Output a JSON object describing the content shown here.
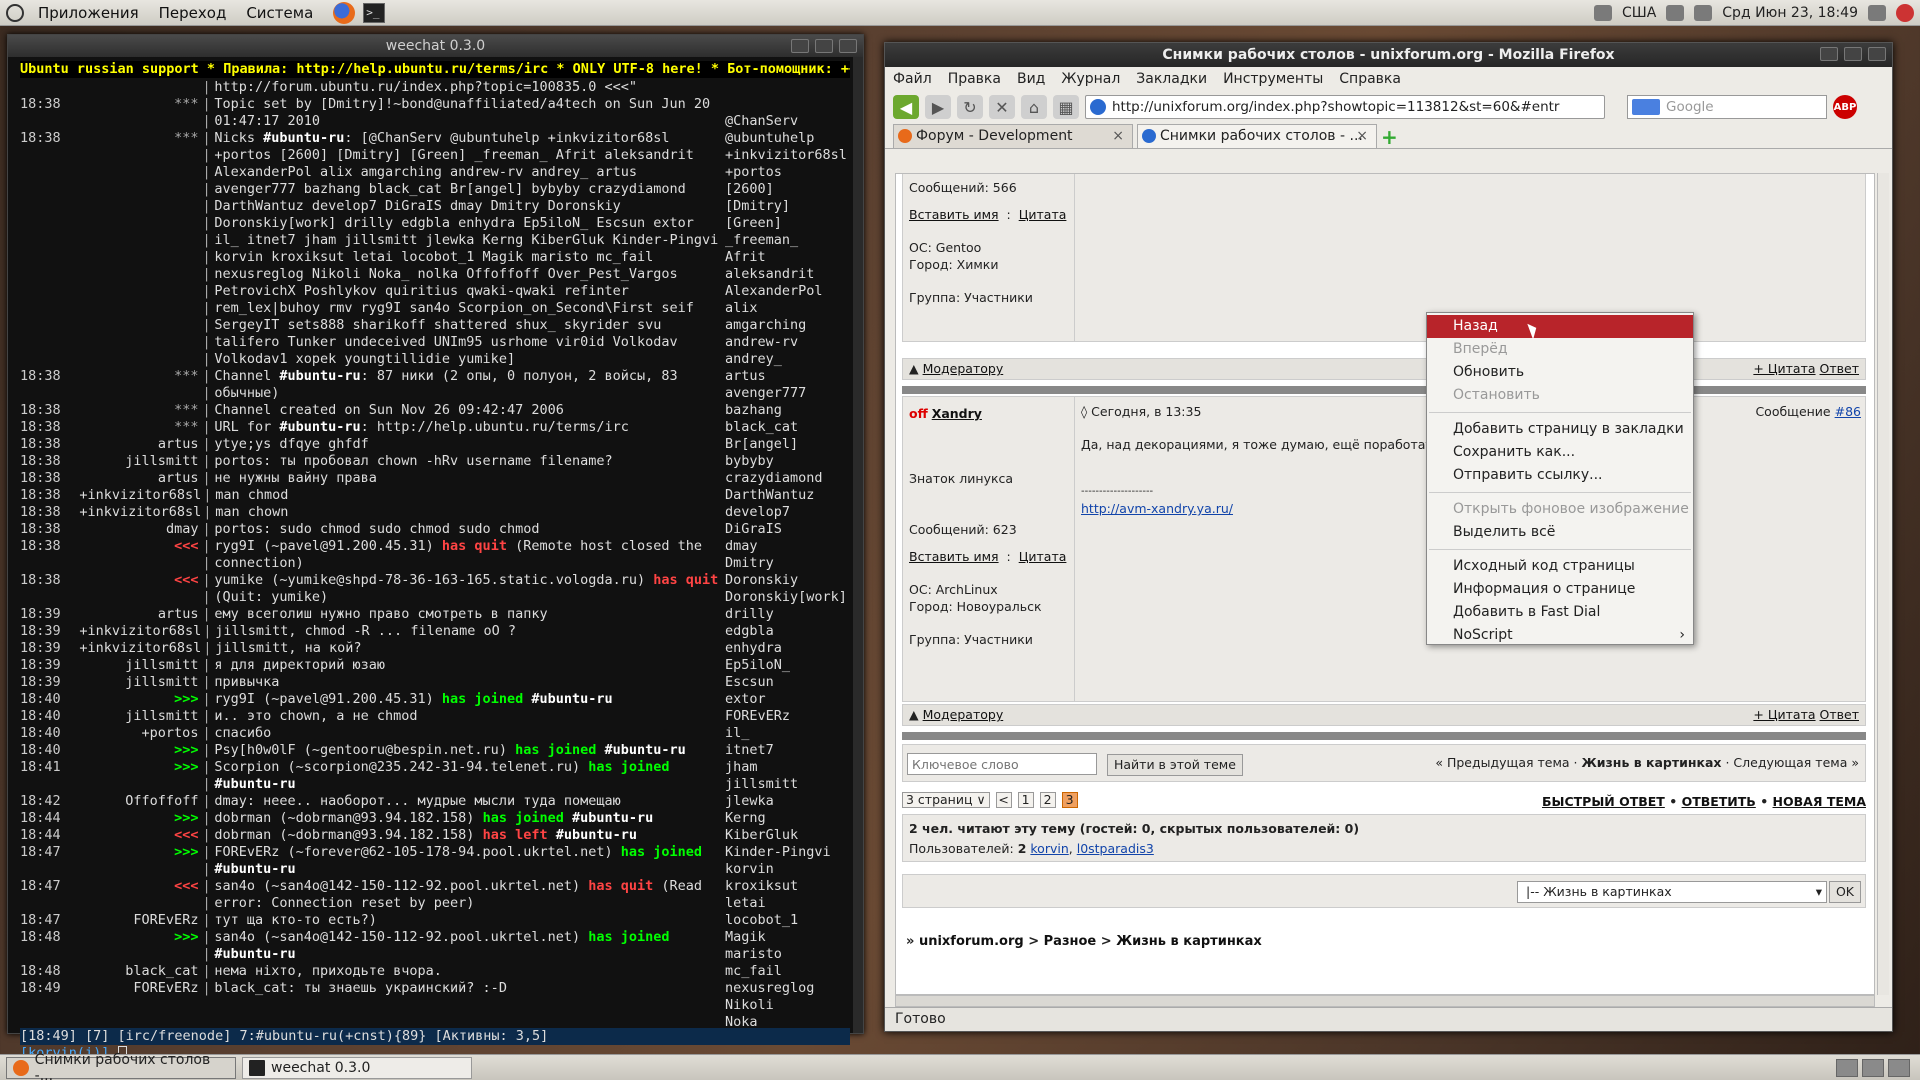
{
  "top_panel": {
    "menus": [
      "Приложения",
      "Переход",
      "Система"
    ],
    "keyboard_layout": "США",
    "datetime": "Срд Июн 23, 18:49"
  },
  "bottom_panel": {
    "tasks": [
      "Снимки рабочих столов -...",
      "weechat 0.3.0"
    ]
  },
  "terminal": {
    "title": "weechat 0.3.0",
    "topic": "Ubuntu russian support * Правила: http://help.ubuntu.ru/terms/irc * ONLY UTF-8 here! * Бот-помощник: ++",
    "lines": [
      {
        "t": "",
        "n": "",
        "m": "http://forum.ubuntu.ru/index.php?topic=100835.0 <<<\""
      },
      {
        "t": "18:38",
        "n": "***",
        "m": "Topic set by [Dmitry]!~bond@unaffiliated/a4tech on Sun Jun 20"
      },
      {
        "t": "",
        "n": "",
        "m": "01:47:17 2010"
      },
      {
        "t": "18:38",
        "n": "***",
        "m": "Nicks #ubuntu-ru: [@ChanServ @ubuntuhelp +inkvizitor68sl"
      },
      {
        "t": "",
        "n": "",
        "m": "+portos [2600] [Dmitry] [Green] _freeman_ Afrit aleksandrit"
      },
      {
        "t": "",
        "n": "",
        "m": "AlexanderPol alix amgarching andrew-rv andrey_ artus"
      },
      {
        "t": "",
        "n": "",
        "m": "avenger777 bazhang black_cat Br[angel] bybyby crazydiamond"
      },
      {
        "t": "",
        "n": "",
        "m": "DarthWantuz develop7 DiGraIS dmay Dmitry Doronskiy"
      },
      {
        "t": "",
        "n": "",
        "m": "Doronskiy[work] drilly edgbla enhydra Ep5iloN_ Escsun extor"
      },
      {
        "t": "",
        "n": "",
        "m": "il_ itnet7 jham jillsmitt jlewka Kerng KiberGluk Kinder-Pingvi"
      },
      {
        "t": "",
        "n": "",
        "m": "korvin kroxiksut letai locobot_1 Magik maristo mc_fail"
      },
      {
        "t": "",
        "n": "",
        "m": "nexusreglog Nikoli Noka_ nolka Offoffoff Over_Pest_Vargos"
      },
      {
        "t": "",
        "n": "",
        "m": "PetrovichX Poshlykov quiritius qwaki-qwaki refinter"
      },
      {
        "t": "",
        "n": "",
        "m": "rem_lex|buhoy rmv ryg9I san4o Scorpion_on_Second\\First seif"
      },
      {
        "t": "",
        "n": "",
        "m": "SergeyIT sets888 sharikoff shattered shux_ skyrider svu"
      },
      {
        "t": "",
        "n": "",
        "m": "talifero Tunker undeceived UNIm95 usrhome vir0id Volkodav"
      },
      {
        "t": "",
        "n": "",
        "m": "Volkodav1 xopek youngtillidie yumike]"
      },
      {
        "t": "18:38",
        "n": "***",
        "m": "Channel #ubuntu-ru: 87 ники (2 опы, 0 полуон, 2 войсы, 83"
      },
      {
        "t": "",
        "n": "",
        "m": "обычные)"
      },
      {
        "t": "18:38",
        "n": "***",
        "m": "Channel created on Sun Nov 26 09:42:47 2006"
      },
      {
        "t": "18:38",
        "n": "***",
        "m": "URL for #ubuntu-ru: http://help.ubuntu.ru/terms/irc"
      },
      {
        "t": "18:38",
        "n": "artus",
        "m": "ytye;ys dfqye ghfdf"
      },
      {
        "t": "18:38",
        "n": "jillsmitt",
        "m": "portos: ты пробовал chown -hRv username filename?"
      },
      {
        "t": "18:38",
        "n": "artus",
        "m": "не нужны вайну права"
      },
      {
        "t": "18:38",
        "n": "+inkvizitor68sl",
        "m": "man chmod"
      },
      {
        "t": "18:38",
        "n": "+inkvizitor68sl",
        "m": "man chown"
      },
      {
        "t": "18:38",
        "n": "dmay",
        "m": "portos: sudo chmod sudo chmod sudo chmod"
      },
      {
        "t": "18:38",
        "n": "<<<",
        "m": "ryg9I (~pavel@91.200.45.31) has quit (Remote host closed the"
      },
      {
        "t": "",
        "n": "",
        "m": "connection)"
      },
      {
        "t": "18:38",
        "n": "<<<",
        "m": "yumike (~yumike@shpd-78-36-163-165.static.vologda.ru) has quit"
      },
      {
        "t": "",
        "n": "",
        "m": "(Quit: yumike)"
      },
      {
        "t": "18:39",
        "n": "artus",
        "m": "ему всеголиш нужно право смотреть в папку"
      },
      {
        "t": "18:39",
        "n": "+inkvizitor68sl",
        "m": "jillsmitt, chmod -R ... filename oO ?"
      },
      {
        "t": "18:39",
        "n": "+inkvizitor68sl",
        "m": "jillsmitt, на кой?"
      },
      {
        "t": "18:39",
        "n": "jillsmitt",
        "m": "я для директорий юзаю"
      },
      {
        "t": "18:39",
        "n": "jillsmitt",
        "m": "привычка"
      },
      {
        "t": "18:40",
        "n": ">>>",
        "m": "ryg9I (~pavel@91.200.45.31) has joined #ubuntu-ru"
      },
      {
        "t": "18:40",
        "n": "jillsmitt",
        "m": "и.. это chown, а не chmod"
      },
      {
        "t": "18:40",
        "n": "+portos",
        "m": "спасибо"
      },
      {
        "t": "18:40",
        "n": ">>>",
        "m": "Psy[h0w0lF (~gentooru@bespin.net.ru) has joined #ubuntu-ru"
      },
      {
        "t": "18:41",
        "n": ">>>",
        "m": "Scorpion (~scorpion@235.242-31-94.telenet.ru) has joined"
      },
      {
        "t": "",
        "n": "",
        "m": "#ubuntu-ru"
      },
      {
        "t": "18:42",
        "n": "Offoffoff",
        "m": "dmay: неее.. наоборот... мудрые мысли туда помещаю"
      },
      {
        "t": "18:44",
        "n": ">>>",
        "m": "dobrman (~dobrman@93.94.182.158) has joined #ubuntu-ru"
      },
      {
        "t": "18:44",
        "n": "<<<",
        "m": "dobrman (~dobrman@93.94.182.158) has left #ubuntu-ru"
      },
      {
        "t": "18:47",
        "n": ">>>",
        "m": "FOREvERz (~forever@62-105-178-94.pool.ukrtel.net) has joined"
      },
      {
        "t": "",
        "n": "",
        "m": "#ubuntu-ru"
      },
      {
        "t": "18:47",
        "n": "<<<",
        "m": "san4o (~san4o@142-150-112-92.pool.ukrtel.net) has quit (Read"
      },
      {
        "t": "",
        "n": "",
        "m": "error: Connection reset by peer)"
      },
      {
        "t": "18:47",
        "n": "FOREvERz",
        "m": "тут ща кто-то есть?)"
      },
      {
        "t": "18:48",
        "n": ">>>",
        "m": "san4o (~san4o@142-150-112-92.pool.ukrtel.net) has joined"
      },
      {
        "t": "",
        "n": "",
        "m": "#ubuntu-ru"
      },
      {
        "t": "18:48",
        "n": "black_cat",
        "m": "нема ніхто, приходьте вчора."
      },
      {
        "t": "18:49",
        "n": "FOREvERz",
        "m": "black_cat: ты знаешь украинский? :-D"
      }
    ],
    "nicks": [
      "@ChanServ",
      "@ubuntuhelp",
      "+inkvizitor68sl",
      "+portos",
      "[2600]",
      "[Dmitry]",
      "[Green]",
      "_freeman_",
      "Afrit",
      "aleksandrit",
      "AlexanderPol",
      "alix",
      "amgarching",
      "andrew-rv",
      "andrey_",
      "artus",
      "avenger777",
      "bazhang",
      "black_cat",
      "Br[angel]",
      "bybyby",
      "crazydiamond",
      "DarthWantuz",
      "develop7",
      "DiGraIS",
      "dmay",
      "Dmitry",
      "Doronskiy",
      "Doronskiy[work]",
      "drilly",
      "edgbla",
      "enhydra",
      "Ep5iloN_",
      "Escsun",
      "extor",
      "FOREvERz",
      "il_",
      "itnet7",
      "jham",
      "jillsmitt",
      "jlewka",
      "Kerng",
      "KiberGluk",
      "Kinder-Pingvi",
      "korvin",
      "kroxiksut",
      "letai",
      "locobot_1",
      "Magik",
      "maristo",
      "mc_fail",
      "nexusreglog",
      "Nikoli",
      "Noka_"
    ],
    "status_line": "[18:49] [7] [irc/freenode] 7:#ubuntu-ru(+cnst){89} [Активны: 3,5]",
    "input_prompt": "[korvin(i)]"
  },
  "firefox": {
    "title": "Снимки рабочих столов - unixforum.org - Mozilla Firefox",
    "menu": [
      "Файл",
      "Правка",
      "Вид",
      "Журнал",
      "Закладки",
      "Инструменты",
      "Справка"
    ],
    "url": "http://unixforum.org/index.php?showtopic=113812&st=60&#entr",
    "search_placeholder": "Google",
    "tabs": [
      "Форум - Development",
      "Снимки рабочих столов - ..."
    ],
    "status": "Готово",
    "post1": {
      "messages": "Сообщений: 566",
      "insert_name": "Вставить имя",
      "quote": "Цитата",
      "os": "ОС: Gentoo",
      "city": "Город: Химки",
      "group": "Группа: Участники",
      "moderator": "Модератору",
      "quote_link": "+ Цитата",
      "reply": "Ответ"
    },
    "post2": {
      "status": "off",
      "author": "Xandry",
      "date": "◊ Сегодня, в 13:35",
      "msg_label": "Сообщение",
      "msg_num": "#86",
      "rank": "Знаток линукса",
      "text": "Да, над декорациями, я тоже думаю, ещё поработать н",
      "sig_line": "--------------------",
      "sig_link": "http://avm-xandry.ya.ru/",
      "messages": "Сообщений: 623",
      "insert_name": "Вставить имя",
      "quote": "Цитата",
      "os": "ОС: ArchLinux",
      "city": "Город: Новоуральск",
      "group": "Группа: Участники",
      "moderator": "Модератору",
      "quote_link": "+ Цитата",
      "reply": "Ответ"
    },
    "search_topic": {
      "placeholder": "Ключевое слово",
      "button": "Найти в этой теме",
      "prev": "« Предыдущая тема",
      "dot": "·",
      "current": "Жизнь в картинках",
      "next": "Следующая тема »"
    },
    "pager": {
      "pages_label": "3 страниц ∨",
      "prev": "<",
      "pages": [
        "1",
        "2",
        "3"
      ],
      "fast_reply": "БЫСТРЫЙ ОТВЕТ",
      "reply": "ОТВЕТИТЬ",
      "new_topic": "НОВАЯ ТЕМА",
      "bullet": "•"
    },
    "readers": {
      "title": "2 чел. читают эту тему (гостей: 0, скрытых пользователей: 0)",
      "users_label": "Пользователей:",
      "users_count": "2",
      "user1": "korvin",
      "user2": "l0stparadis3"
    },
    "jump": {
      "selected": "|-- Жизнь в картинках",
      "ok": "OK"
    },
    "breadcrumb": {
      "b1": "unixforum.org",
      "b2": "Разное",
      "b3": "Жизнь в картинках",
      "sep": ">",
      "lead": "»"
    }
  },
  "context_menu": {
    "items": [
      {
        "label": "Назад",
        "state": "selected"
      },
      {
        "label": "Вперёд",
        "state": "disabled"
      },
      {
        "label": "Обновить",
        "state": "normal"
      },
      {
        "label": "Остановить",
        "state": "disabled"
      },
      {
        "sep": true
      },
      {
        "label": "Добавить страницу в закладки",
        "state": "normal"
      },
      {
        "label": "Сохранить как...",
        "state": "normal"
      },
      {
        "label": "Отправить ссылку...",
        "state": "normal"
      },
      {
        "sep": true
      },
      {
        "label": "Открыть фоновое изображение",
        "state": "disabled"
      },
      {
        "label": "Выделить всё",
        "state": "normal"
      },
      {
        "sep": true
      },
      {
        "label": "Исходный код страницы",
        "state": "normal"
      },
      {
        "label": "Информация о странице",
        "state": "normal"
      },
      {
        "label": "Добавить в Fast Dial",
        "state": "normal"
      },
      {
        "label": "NoScript",
        "state": "normal",
        "submenu": true
      }
    ]
  }
}
